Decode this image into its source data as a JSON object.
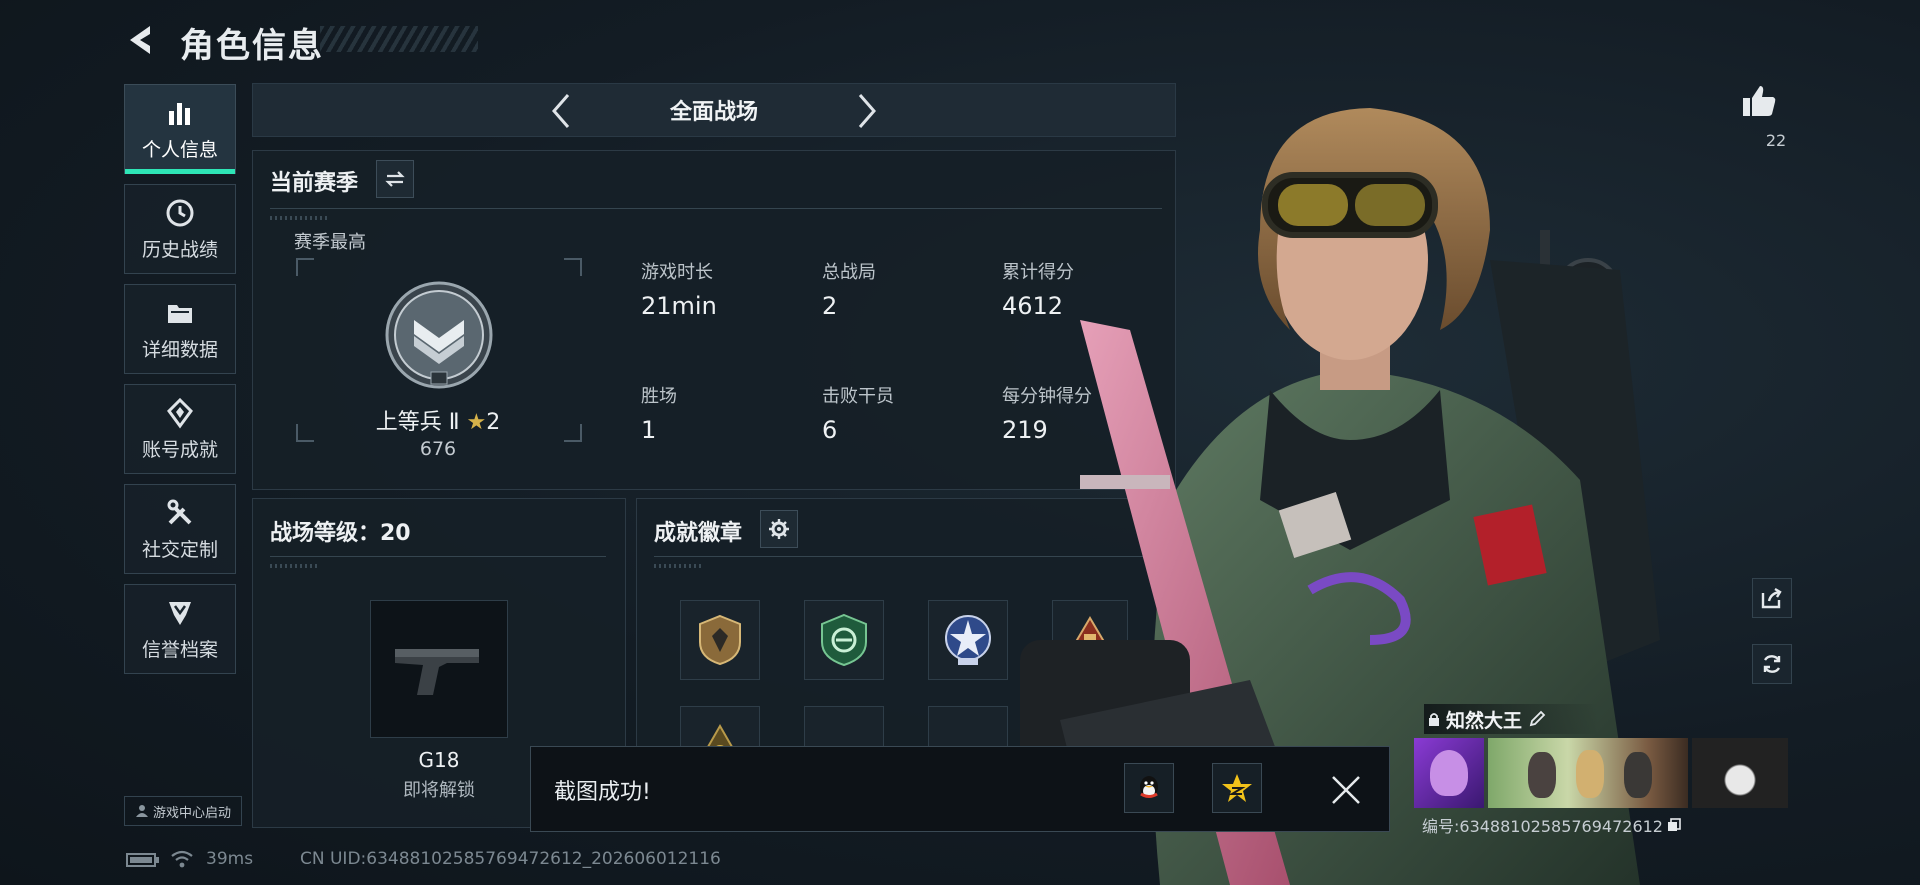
{
  "header": {
    "title": "角色信息"
  },
  "nav": {
    "items": [
      {
        "label": "个人信息",
        "icon": "bar-chart-icon",
        "active": true
      },
      {
        "label": "历史战绩",
        "icon": "clock-icon"
      },
      {
        "label": "详细数据",
        "icon": "folder-icon"
      },
      {
        "label": "账号成就",
        "icon": "medal-icon"
      },
      {
        "label": "社交定制",
        "icon": "tools-icon"
      },
      {
        "label": "信誉档案",
        "icon": "shield-icon"
      }
    ],
    "game_center": "游戏中心启动"
  },
  "mode": {
    "title": "全面战场"
  },
  "season": {
    "title": "当前赛季",
    "highest_label": "赛季最高",
    "rank_name": "上等兵 Ⅱ",
    "rank_stars": "2",
    "rank_points": "676",
    "stats": [
      {
        "label": "游戏时长",
        "value": "21min"
      },
      {
        "label": "总战局",
        "value": "2"
      },
      {
        "label": "累计得分",
        "value": "4612"
      },
      {
        "label": "胜场",
        "value": "1"
      },
      {
        "label": "击败干员",
        "value": "6"
      },
      {
        "label": "每分钟得分",
        "value": "219"
      }
    ]
  },
  "battlefield": {
    "title": "战场等级：20",
    "weapon_name": "G18",
    "weapon_status": "即将解锁"
  },
  "achievements": {
    "title": "成就徽章"
  },
  "toast": {
    "text": "截图成功!"
  },
  "profile": {
    "likes": "22",
    "player_name": "知然大王",
    "player_id": "编号:6348810258576947261​2"
  },
  "status_bar": {
    "ping": "39ms",
    "uid": "CN UID:6348810258576947261​2_202606012116"
  },
  "colors": {
    "accent": "#2ee5b6",
    "panel": "#161f27",
    "background": "#131c24"
  }
}
